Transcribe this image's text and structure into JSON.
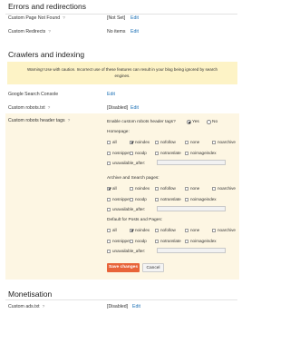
{
  "errors": {
    "title": "Errors and redirections",
    "rows": [
      {
        "label": "Custom Page Not Found",
        "value": "[Not Set]",
        "edit": "Edit"
      },
      {
        "label": "Custom Redirects",
        "value": "No items",
        "edit": "Edit"
      }
    ]
  },
  "crawlers": {
    "title": "Crawlers and indexing",
    "warning_line1": "Warning! Use with caution. Incorrect use of these features can result in your blog being ignored by search",
    "warning_line2": "engines.",
    "console": {
      "label": "Google Search Console",
      "edit": "Edit"
    },
    "robots": {
      "label": "Custom robots.txt",
      "value": "[Disabled]",
      "edit": "Edit"
    },
    "header_tags": {
      "label": "Custom robots header tags",
      "enable_question": "Enable custom robots header tags?",
      "yes": "Yes",
      "no": "No",
      "selected": "Yes",
      "groups": [
        {
          "title": "Homepage:",
          "options": [
            {
              "label": "all",
              "checked": false
            },
            {
              "label": "noindex",
              "checked": true
            },
            {
              "label": "nofollow",
              "checked": false
            },
            {
              "label": "none",
              "checked": false
            },
            {
              "label": "noarchive",
              "checked": false
            },
            {
              "label": "nosnippet",
              "checked": false
            },
            {
              "label": "noodp",
              "checked": false
            },
            {
              "label": "notranslate",
              "checked": false
            },
            {
              "label": "noimageindex",
              "checked": false
            },
            {
              "label": "unavailable_after:",
              "checked": false
            }
          ]
        },
        {
          "title": "Archive and Search pages:",
          "options": [
            {
              "label": "all",
              "checked": true
            },
            {
              "label": "noindex",
              "checked": false
            },
            {
              "label": "nofollow",
              "checked": false
            },
            {
              "label": "none",
              "checked": false
            },
            {
              "label": "noarchive",
              "checked": false
            },
            {
              "label": "nosnippet",
              "checked": false
            },
            {
              "label": "noodp",
              "checked": false
            },
            {
              "label": "notranslate",
              "checked": false
            },
            {
              "label": "noimageindex",
              "checked": false
            },
            {
              "label": "unavailable_after:",
              "checked": false
            }
          ]
        },
        {
          "title": "Default for Posts and Pages:",
          "options": [
            {
              "label": "all",
              "checked": false
            },
            {
              "label": "noindex",
              "checked": true
            },
            {
              "label": "nofollow",
              "checked": false
            },
            {
              "label": "none",
              "checked": false
            },
            {
              "label": "noarchive",
              "checked": false
            },
            {
              "label": "nosnippet",
              "checked": false
            },
            {
              "label": "noodp",
              "checked": false
            },
            {
              "label": "notranslate",
              "checked": false
            },
            {
              "label": "noimageindex",
              "checked": false
            },
            {
              "label": "unavailable_after:",
              "checked": false
            }
          ]
        }
      ],
      "save": "Save changes",
      "cancel": "Cancel"
    }
  },
  "monetisation": {
    "title": "Monetisation",
    "ads": {
      "label": "Custom ads.txt",
      "value": "[Disabled]",
      "edit": "Edit"
    }
  },
  "help_icon": "question-mark-icon",
  "colors": {
    "link": "#1a6fb5",
    "save": "#e8643a",
    "warning_bg": "#fdf3c6",
    "panel_bg": "#fdf6e3"
  }
}
